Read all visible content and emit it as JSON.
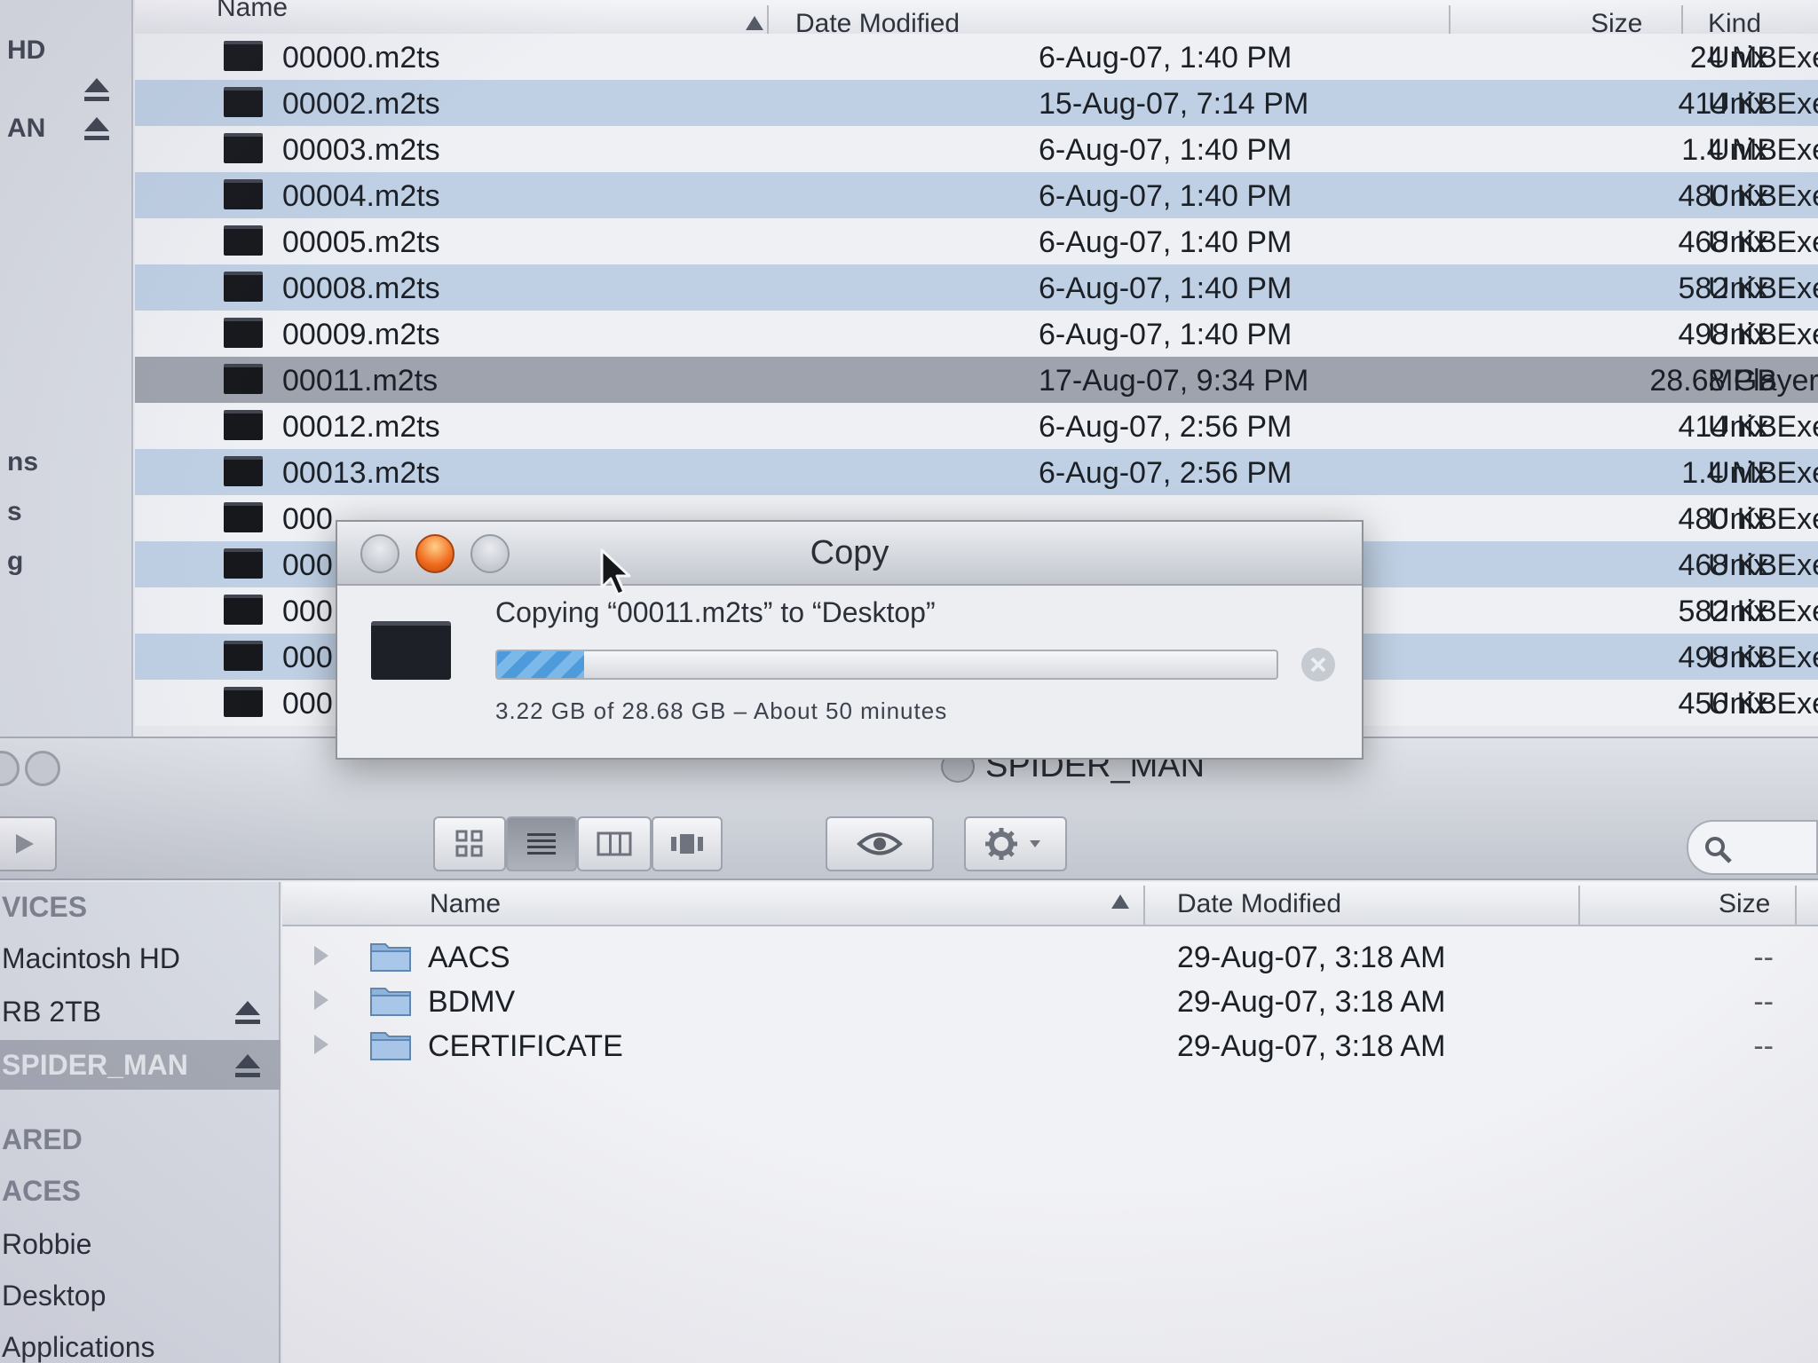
{
  "top_window": {
    "sidebar": [
      {
        "label": "HD",
        "eject": false
      },
      {
        "label": "",
        "eject": true
      },
      {
        "label": "AN",
        "eject": true
      },
      {
        "label": "ns",
        "eject": false
      },
      {
        "label": "s",
        "eject": false
      },
      {
        "label": "g",
        "eject": false
      }
    ],
    "columns": {
      "name": "Name",
      "date": "Date Modified",
      "size": "Size",
      "kind": "Kind"
    },
    "rows": [
      {
        "name": "00000.m2ts",
        "date": "6-Aug-07, 1:40 PM",
        "size": "24 MB",
        "kind": "Unix Exe",
        "selected": false
      },
      {
        "name": "00002.m2ts",
        "date": "15-Aug-07, 7:14 PM",
        "size": "414 KB",
        "kind": "Unix Exe",
        "selected": false
      },
      {
        "name": "00003.m2ts",
        "date": "6-Aug-07, 1:40 PM",
        "size": "1.4 MB",
        "kind": "Unix Exe",
        "selected": false
      },
      {
        "name": "00004.m2ts",
        "date": "6-Aug-07, 1:40 PM",
        "size": "480 KB",
        "kind": "Unix Exe",
        "selected": false
      },
      {
        "name": "00005.m2ts",
        "date": "6-Aug-07, 1:40 PM",
        "size": "468 KB",
        "kind": "Unix Exe",
        "selected": false
      },
      {
        "name": "00008.m2ts",
        "date": "6-Aug-07, 1:40 PM",
        "size": "582 KB",
        "kind": "Unix Exe",
        "selected": false
      },
      {
        "name": "00009.m2ts",
        "date": "6-Aug-07, 1:40 PM",
        "size": "498 KB",
        "kind": "Unix Exe",
        "selected": false
      },
      {
        "name": "00011.m2ts",
        "date": "17-Aug-07, 9:34 PM",
        "size": "28.68 GB",
        "kind": "MPlayer",
        "selected": true
      },
      {
        "name": "00012.m2ts",
        "date": "6-Aug-07, 2:56 PM",
        "size": "414 KB",
        "kind": "Unix Exe",
        "selected": false
      },
      {
        "name": "00013.m2ts",
        "date": "6-Aug-07, 2:56 PM",
        "size": "1.4 MB",
        "kind": "Unix Exe",
        "selected": false
      },
      {
        "name": "000",
        "date": "",
        "size": "480 KB",
        "kind": "Unix Exe",
        "selected": false
      },
      {
        "name": "000",
        "date": "",
        "size": "468 KB",
        "kind": "Unix Exe",
        "selected": false
      },
      {
        "name": "000",
        "date": "",
        "size": "582 KB",
        "kind": "Unix Exe",
        "selected": false
      },
      {
        "name": "000",
        "date": "",
        "size": "498 KB",
        "kind": "Unix Exe",
        "selected": false
      },
      {
        "name": "000",
        "date": "",
        "size": "456 KB",
        "kind": "Unix Exe",
        "selected": false
      }
    ]
  },
  "copy_dialog": {
    "title": "Copy",
    "message": "Copying “00011.m2ts” to “Desktop”",
    "status": "3.22 GB of 28.68 GB – About 50 minutes",
    "progress_fraction": 0.112
  },
  "bottom_window": {
    "title": "SPIDER_MAN",
    "sidebar": [
      {
        "label": "VICES",
        "type": "head"
      },
      {
        "label": "Macintosh HD",
        "type": "item"
      },
      {
        "label": "RB 2TB",
        "type": "item",
        "eject": true
      },
      {
        "label": "SPIDER_MAN",
        "type": "sel",
        "eject": true
      },
      {
        "label": "ARED",
        "type": "head"
      },
      {
        "label": "ACES",
        "type": "head"
      },
      {
        "label": "Robbie",
        "type": "item"
      },
      {
        "label": "Desktop",
        "type": "item"
      },
      {
        "label": "Applications",
        "type": "item"
      }
    ],
    "columns": {
      "name": "Name",
      "date": "Date Modified",
      "size": "Size"
    },
    "rows": [
      {
        "name": "AACS",
        "date": "29-Aug-07, 3:18 AM",
        "size": "--"
      },
      {
        "name": "BDMV",
        "date": "29-Aug-07, 3:18 AM",
        "size": "--"
      },
      {
        "name": "CERTIFICATE",
        "date": "29-Aug-07, 3:18 AM",
        "size": "--"
      }
    ]
  },
  "icons": {
    "file": "file-icon",
    "folder": "folder-icon",
    "eject": "eject-icon",
    "quicklook": "eye-icon",
    "action": "gear-icon",
    "search": "search-icon"
  },
  "colors": {
    "selection": "#9ea3ad",
    "alt_row": "#bfd0e4",
    "progress": "#4e9bdc",
    "close_button": "#f06a1d"
  }
}
